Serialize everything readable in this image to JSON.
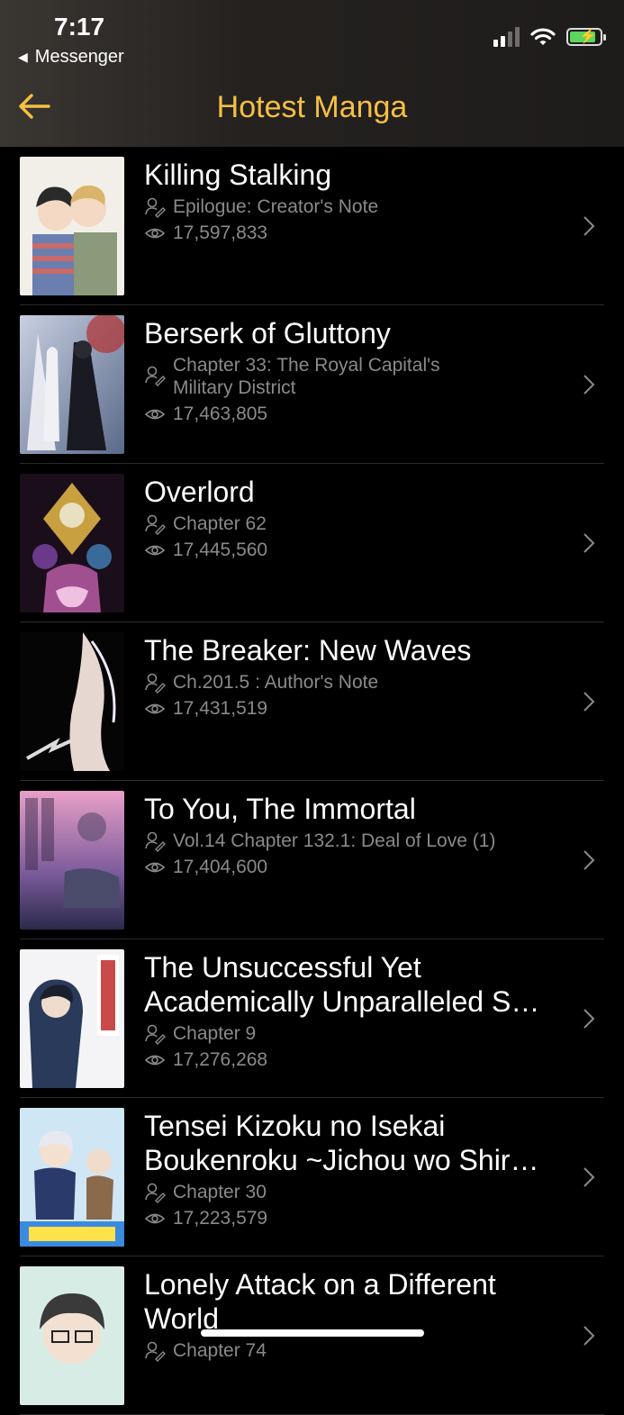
{
  "status_bar": {
    "time": "7:17",
    "back_app": "Messenger"
  },
  "nav": {
    "title": "Hotest Manga"
  },
  "colors": {
    "accent": "#f5c043",
    "meta": "#8a8a8a",
    "background": "#000000"
  },
  "items": [
    {
      "title": "Killing Stalking",
      "chapter": "Epilogue: Creator's Note",
      "views": "17,597,833"
    },
    {
      "title": "Berserk of Gluttony",
      "chapter": "Chapter 33: The Royal Capital's Military District",
      "views": "17,463,805"
    },
    {
      "title": "Overlord",
      "chapter": "Chapter 62",
      "views": "17,445,560"
    },
    {
      "title": "The Breaker: New Waves",
      "chapter": "Ch.201.5 : Author's Note",
      "views": "17,431,519"
    },
    {
      "title": "To You, The Immortal",
      "chapter": "Vol.14 Chapter 132.1: Deal of Love (1)",
      "views": "17,404,600"
    },
    {
      "title": "The Unsuccessful Yet Academically Unparalleled S…",
      "chapter": "Chapter 9",
      "views": "17,276,268"
    },
    {
      "title": "Tensei Kizoku no Isekai Boukenroku ~Jichou wo Shir…",
      "chapter": "Chapter 30",
      "views": "17,223,579"
    },
    {
      "title": "Lonely Attack on a Different World",
      "chapter": "Chapter 74",
      "views": ""
    }
  ]
}
